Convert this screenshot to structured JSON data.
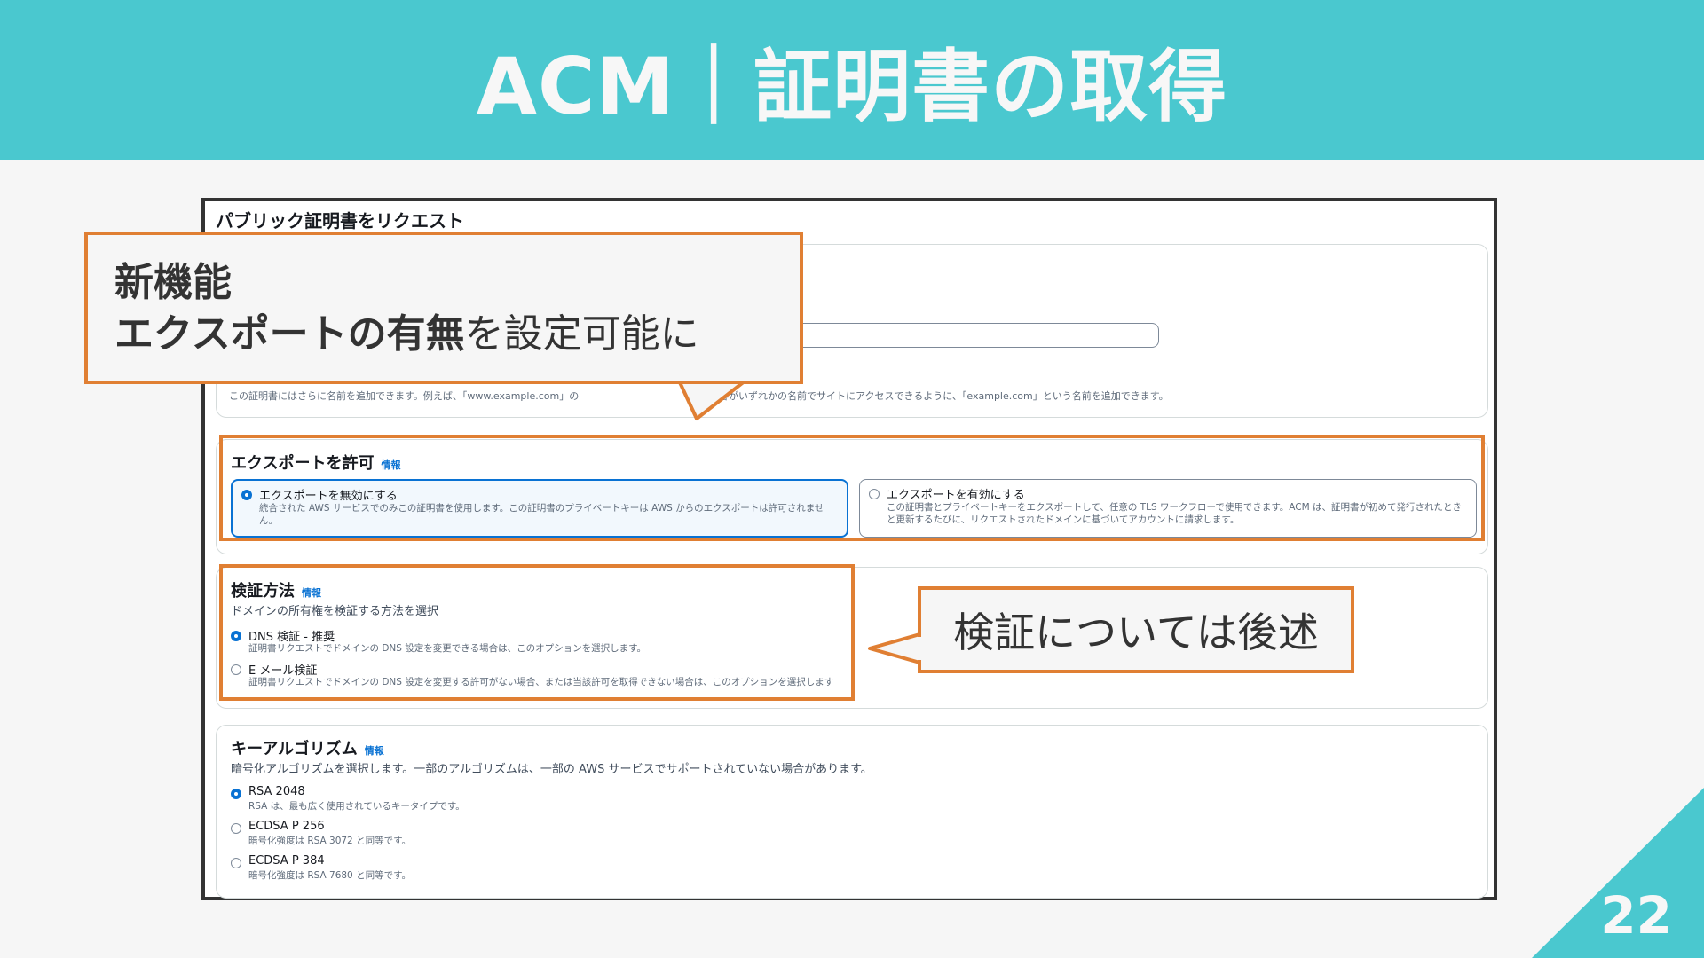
{
  "slide": {
    "title": "ACM｜証明書の取得",
    "page_number": "22",
    "colors": {
      "header": "#4ac8cf",
      "highlight": "#e07f33",
      "accent": "#0972d3"
    }
  },
  "console": {
    "page_title": "パブリック証明書をリクエスト",
    "domain_section": {
      "hint_left": "この証明書にはさらに名前を追加できます。例えば、「www.example.com」の",
      "hint_right": "顧客がいずれかの名前でサイトにアクセスできるように、「example.com」という名前を追加できます。"
    },
    "export_section": {
      "title": "エクスポートを許可",
      "info": "情報",
      "options": [
        {
          "label": "エクスポートを無効にする",
          "desc": "統合された AWS サービスでのみこの証明書を使用します。この証明書のプライベートキーは AWS からのエクスポートは許可されませ ん。",
          "selected": true
        },
        {
          "label": "エクスポートを有効にする",
          "desc": "この証明書とプライベートキーをエクスポートして、任意の TLS ワークフローで使用できます。ACM は、証明書が初めて発行されたときと更新するたびに、リクエストされたドメインに基づいてアカウントに請求します。",
          "selected": false
        }
      ]
    },
    "validation_section": {
      "title": "検証方法",
      "info": "情報",
      "subtitle": "ドメインの所有権を検証する方法を選択",
      "options": [
        {
          "label": "DNS 検証 - 推奨",
          "desc": "証明書リクエストでドメインの DNS 設定を変更できる場合は、このオプションを選択します。",
          "selected": true
        },
        {
          "label": "E メール検証",
          "desc": "証明書リクエストでドメインの DNS 設定を変更する許可がない場合、または当該許可を取得できない場合は、このオプションを選択します",
          "selected": false
        }
      ]
    },
    "key_section": {
      "title": "キーアルゴリズム",
      "info": "情報",
      "subtitle": "暗号化アルゴリズムを選択します。一部のアルゴリズムは、一部の AWS サービスでサポートされていない場合があります。",
      "options": [
        {
          "label": "RSA 2048",
          "desc": "RSA は、最も広く使用されているキータイプです。",
          "selected": true
        },
        {
          "label": "ECDSA P 256",
          "desc": "暗号化強度は RSA 3072 と同等です。",
          "selected": false
        },
        {
          "label": "ECDSA P 384",
          "desc": "暗号化強度は RSA 7680 と同等です。",
          "selected": false
        }
      ]
    }
  },
  "callouts": {
    "new_feature": {
      "line1": "新機能",
      "line2_bold": "エクスポートの有無",
      "line2_rest": "を設定可能に"
    },
    "validation_note": "検証については後述"
  }
}
